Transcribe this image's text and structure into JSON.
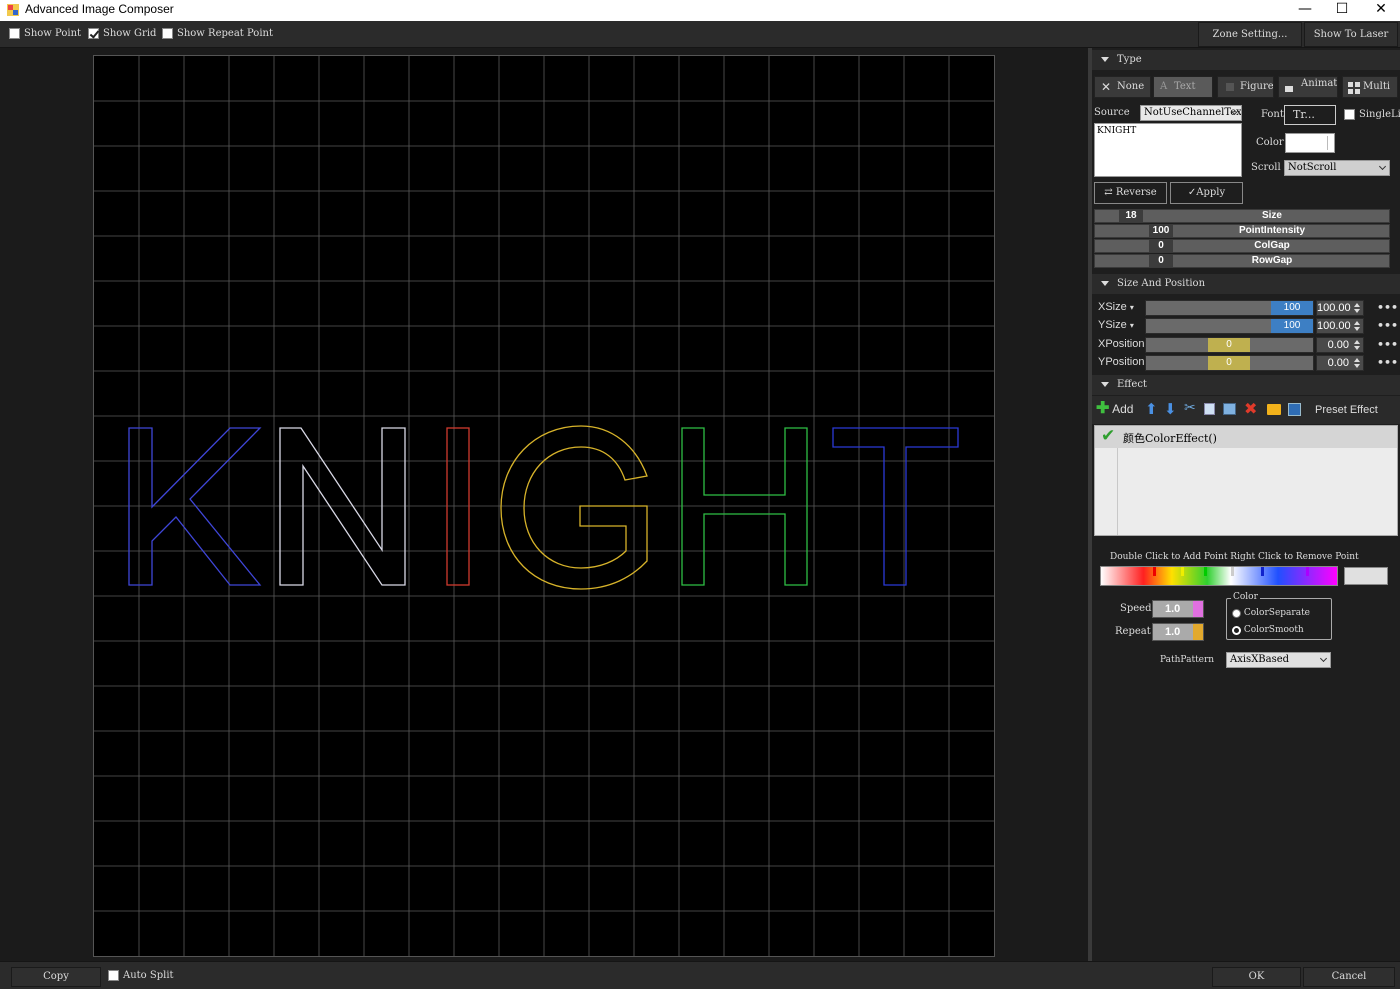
{
  "window": {
    "title": "Advanced Image Composer",
    "minimize": "—",
    "maximize": "☐",
    "close": "✕"
  },
  "toolbar": {
    "show_point": {
      "label": "Show Point",
      "checked": false
    },
    "show_grid": {
      "label": "Show Grid",
      "checked": true
    },
    "show_repeat_point": {
      "label": "Show Repeat Point",
      "checked": false
    },
    "zone_setting": "Zone Setting...",
    "show_to_laser": "Show To Laser"
  },
  "canvas": {
    "text": "KNIGHT",
    "grid_divisions": 20,
    "grid_color": "#5a5a5a",
    "letter_colors": [
      "#3f46d8",
      "#d9d9e6",
      "#d03a2f",
      "#d7b32a",
      "#2fbf45",
      "#2b39d6"
    ]
  },
  "type_section": {
    "header": "Type",
    "buttons": {
      "none": "None",
      "text": "Text",
      "figure": "Figure",
      "animat": "Animat",
      "multi": "Multi"
    },
    "source_label": "Source",
    "source_value": "NotUseChannelTex",
    "text_value": "KNIGHT",
    "font_label": "Font",
    "font_value": "Tr...",
    "single_line_label": "SingleLi",
    "color_label": "Color",
    "scroll_label": "Scroll",
    "scroll_value": "NotScroll",
    "reverse": "Reverse",
    "apply": "Apply",
    "sliders": [
      {
        "value": "18",
        "name": "Size"
      },
      {
        "value": "100",
        "name": "PointIntensity"
      },
      {
        "value": "0",
        "name": "ColGap"
      },
      {
        "value": "0",
        "name": "RowGap"
      }
    ]
  },
  "size_position": {
    "header": "Size And Position",
    "rows": [
      {
        "label": "XSize",
        "has_dropdown": true,
        "bar_value": "100",
        "value": "100.00",
        "accent": "#3d7fc4"
      },
      {
        "label": "YSize",
        "has_dropdown": true,
        "bar_value": "100",
        "value": "100.00",
        "accent": "#3d7fc4"
      },
      {
        "label": "XPosition",
        "has_dropdown": false,
        "bar_value": "0",
        "value": "0.00",
        "accent": "#bfb04f"
      },
      {
        "label": "YPosition",
        "has_dropdown": false,
        "bar_value": "0",
        "value": "0.00",
        "accent": "#bfb04f"
      }
    ],
    "more": "•••"
  },
  "effect": {
    "header": "Effect",
    "add": "Add",
    "preset": "Preset Effect",
    "items": [
      {
        "label": "颜色ColorEffect()",
        "enabled": true
      }
    ],
    "gradient_hint": "Double Click to Add Point Right Click to Remove Point",
    "speed_label": "Speed",
    "speed_value": "1.0",
    "repeat_label": "Repeat",
    "repeat_value": "1.0",
    "color_group_label": "Color",
    "color_separate": "ColorSeparate",
    "color_smooth": "ColorSmooth",
    "color_mode": "ColorSmooth",
    "path_pattern_label": "PathPattern",
    "path_pattern_value": "AxisXBased"
  },
  "statusbar": {
    "copy": "Copy",
    "auto_split": {
      "label": "Auto Split",
      "checked": false
    },
    "ok": "OK",
    "cancel": "Cancel"
  }
}
